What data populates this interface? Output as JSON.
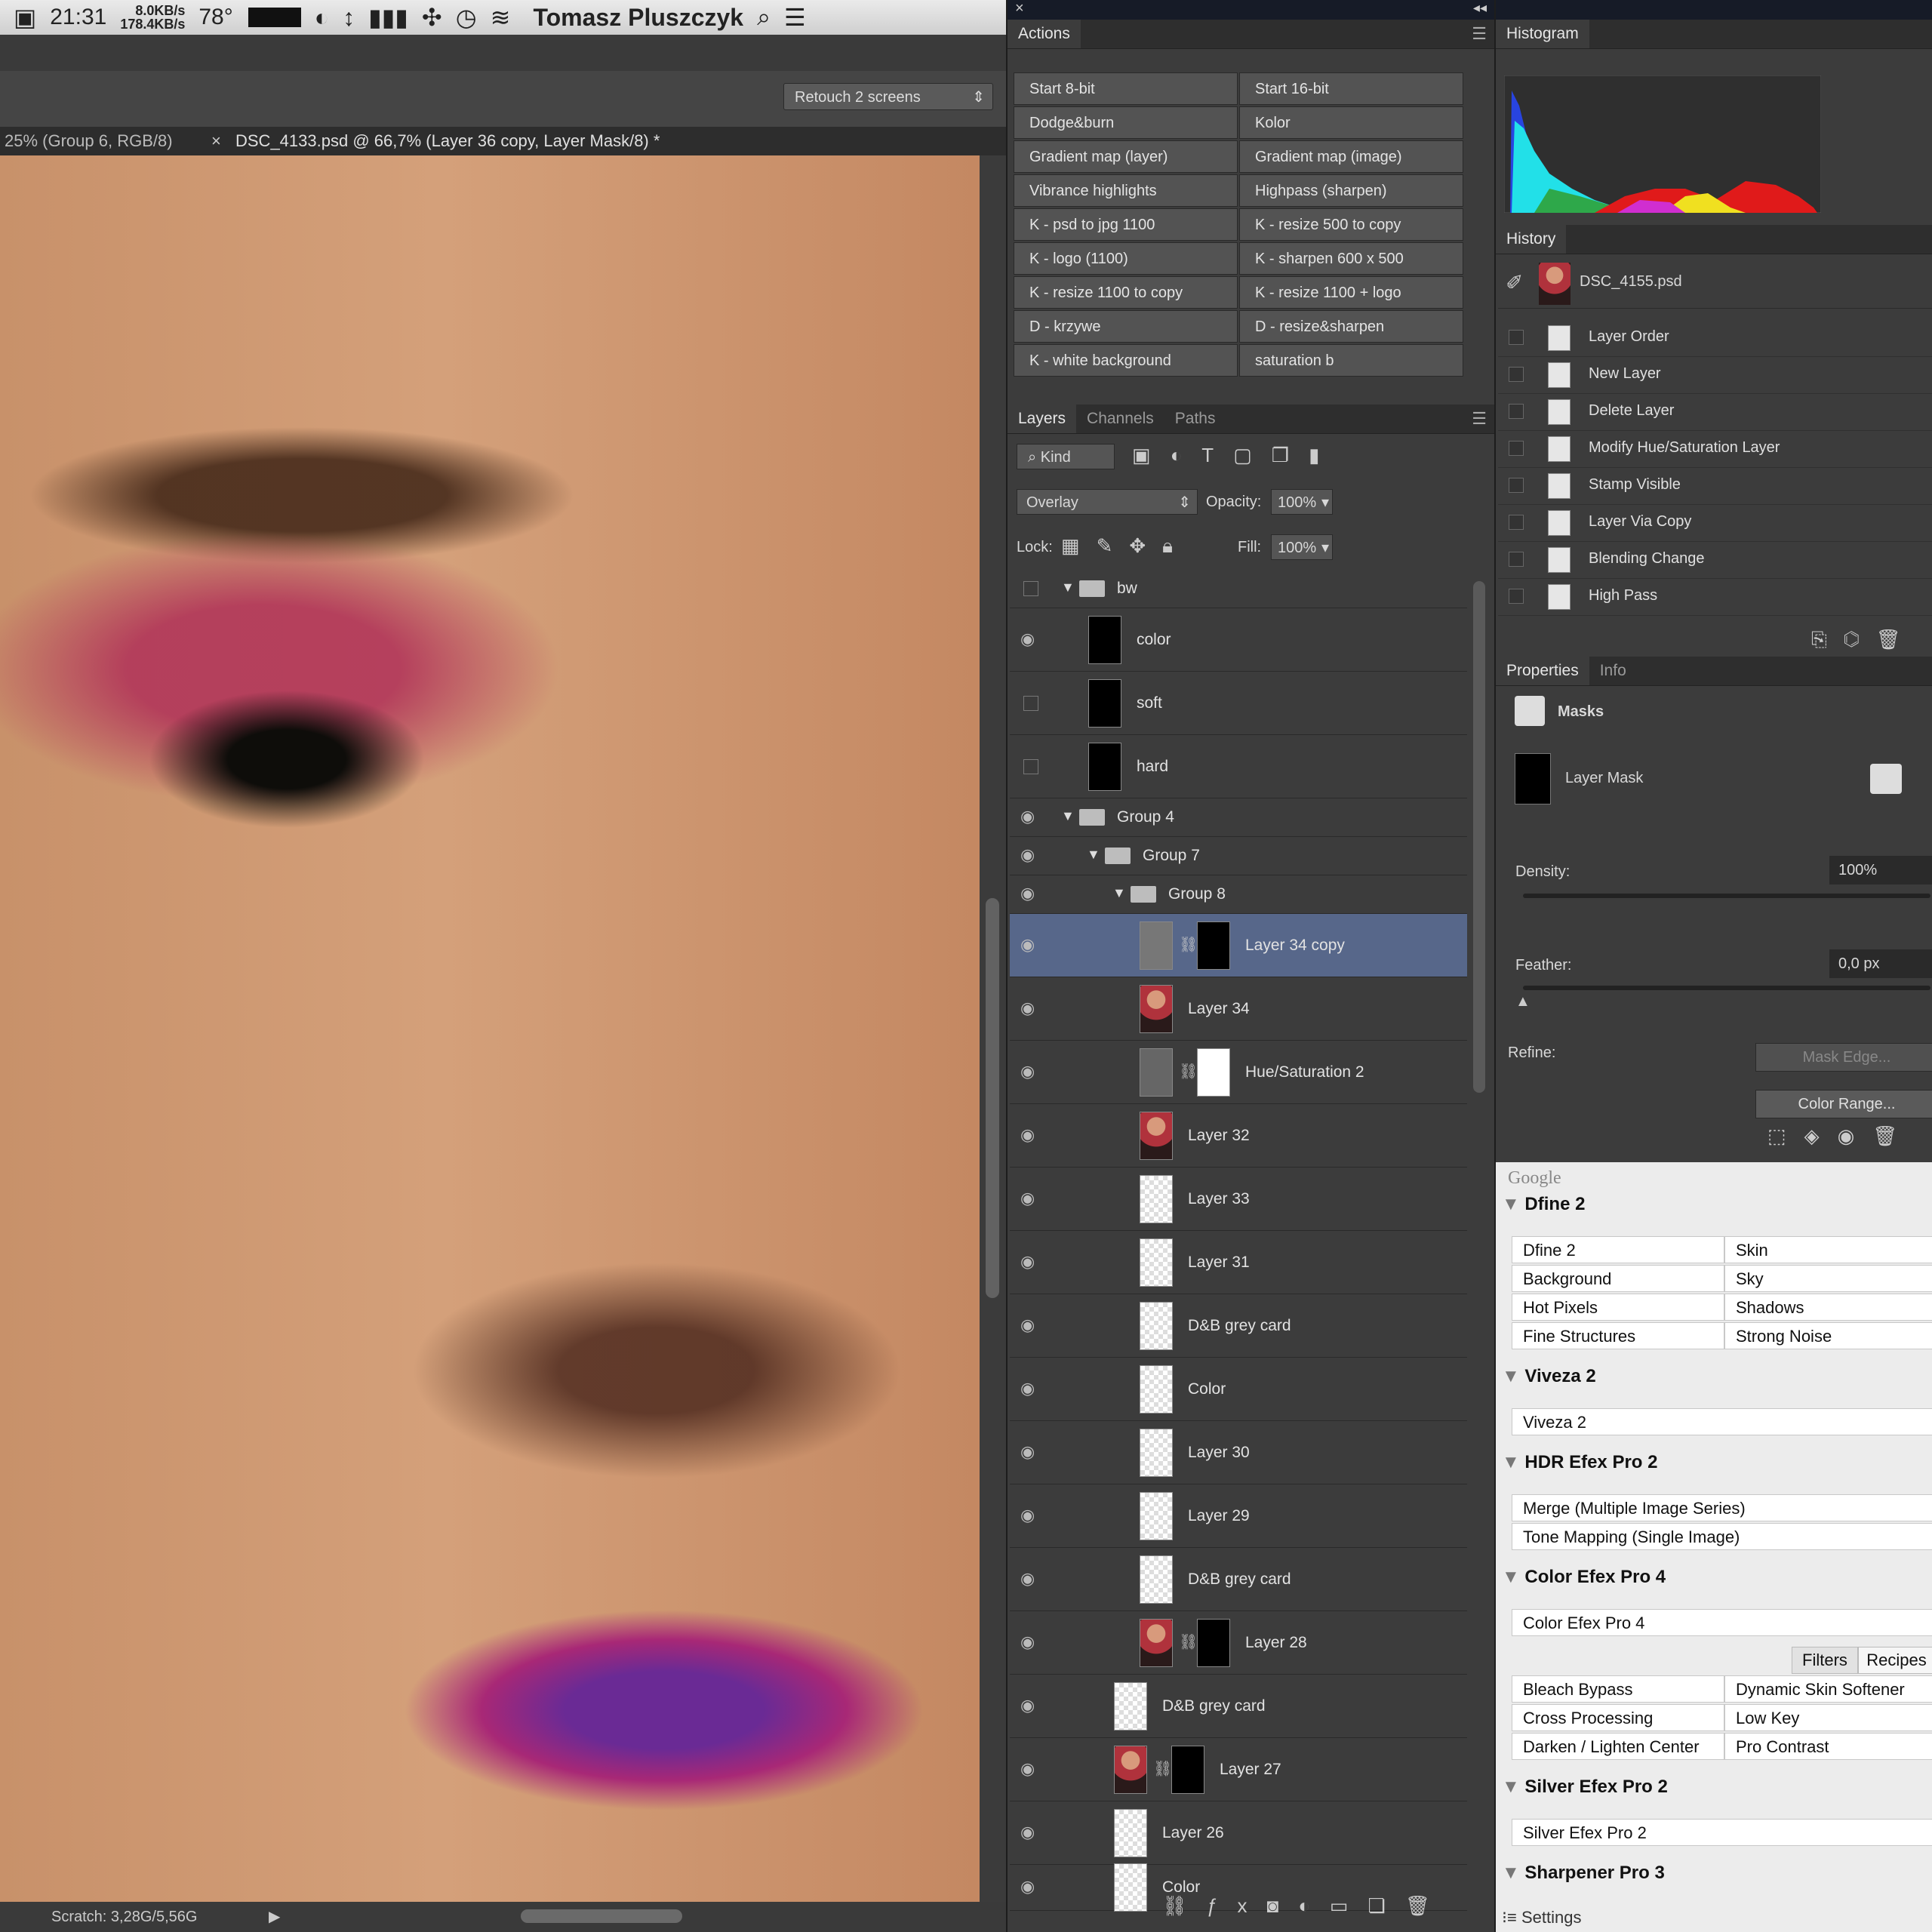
{
  "menubar": {
    "time": "21:31",
    "net_up": "8.0KB/s",
    "net_down": "178.4KB/s",
    "temp": "78°",
    "user": "Tomasz Pluszczyk"
  },
  "document": {
    "workspace": "Retouch 2 screens",
    "tab_inactive": "25% (Group 6, RGB/8)",
    "tab_active": "DSC_4133.psd @ 66,7% (Layer 36 copy, Layer Mask/8) *",
    "status": "Scratch: 3,28G/5,56G"
  },
  "actions": {
    "title": "Actions",
    "items": [
      "Start 8-bit",
      "Start 16-bit",
      "Dodge&burn",
      "Kolor",
      "Gradient map (layer)",
      "Gradient map (image)",
      "Vibrance highlights",
      "Highpass (sharpen)",
      "K - psd to jpg 1100",
      "K - resize 500 to copy",
      "K - logo (1100)",
      "K - sharpen 600 x 500",
      "K - resize 1100 to copy",
      "K - resize 1100 + logo",
      "D - krzywe",
      "D - resize&sharpen",
      "K - white background",
      "saturation b"
    ]
  },
  "layers_panel": {
    "tabs": [
      "Layers",
      "Channels",
      "Paths"
    ],
    "kind": "Kind",
    "blend": "Overlay",
    "opacity_label": "Opacity:",
    "opacity": "100%",
    "lock_label": "Lock:",
    "fill_label": "Fill:",
    "fill": "100%",
    "layers": [
      {
        "name": "bw"
      },
      {
        "name": "color"
      },
      {
        "name": "soft"
      },
      {
        "name": "hard"
      },
      {
        "name": "Group 4"
      },
      {
        "name": "Group 7"
      },
      {
        "name": "Group 8"
      },
      {
        "name": "Layer 34 copy"
      },
      {
        "name": "Layer 34"
      },
      {
        "name": "Hue/Saturation 2"
      },
      {
        "name": "Layer 32"
      },
      {
        "name": "Layer 33"
      },
      {
        "name": "Layer 31"
      },
      {
        "name": "D&B grey card"
      },
      {
        "name": "Color"
      },
      {
        "name": "Layer 30"
      },
      {
        "name": "Layer 29"
      },
      {
        "name": "D&B grey card"
      },
      {
        "name": "Layer 28"
      },
      {
        "name": "D&B grey card"
      },
      {
        "name": "Layer 27"
      },
      {
        "name": "Layer 26"
      },
      {
        "name": "Color"
      }
    ]
  },
  "histogram": {
    "title": "Histogram"
  },
  "history": {
    "title": "History",
    "snapshot": "DSC_4155.psd",
    "items": [
      "Layer Order",
      "New Layer",
      "Delete Layer",
      "Modify Hue/Saturation Layer",
      "Stamp Visible",
      "Layer Via Copy",
      "Blending Change",
      "High Pass"
    ]
  },
  "properties": {
    "tabs": [
      "Properties",
      "Info"
    ],
    "heading": "Masks",
    "mask_name": "Layer Mask",
    "density_label": "Density:",
    "density": "100%",
    "feather_label": "Feather:",
    "feather": "0,0 px",
    "refine_label": "Refine:",
    "mask_edge": "Mask Edge...",
    "color_range": "Color Range..."
  },
  "google": {
    "title": "Google",
    "sections": [
      {
        "name": "Dfine 2",
        "cells": [
          "Dfine 2",
          "Skin",
          "Background",
          "Sky",
          "Hot Pixels",
          "Shadows",
          "Fine Structures",
          "Strong Noise"
        ]
      },
      {
        "name": "Viveza 2",
        "cells": [
          "Viveza 2"
        ]
      },
      {
        "name": "HDR Efex Pro 2",
        "cells": [
          "Merge (Multiple Image Series)",
          "Tone Mapping (Single Image)"
        ]
      },
      {
        "name": "Color Efex Pro 4",
        "cells": [
          "Color Efex Pro 4"
        ],
        "subtabs": [
          "Filters",
          "Recipes"
        ],
        "cells2": [
          "Bleach Bypass",
          "Dynamic Skin Softener",
          "Cross Processing",
          "Low Key",
          "Darken / Lighten Center",
          "Pro Contrast"
        ]
      },
      {
        "name": "Silver Efex Pro 2",
        "cells": [
          "Silver Efex Pro 2"
        ]
      },
      {
        "name": "Sharpener Pro 3",
        "cells": []
      }
    ],
    "settings": "Settings"
  }
}
